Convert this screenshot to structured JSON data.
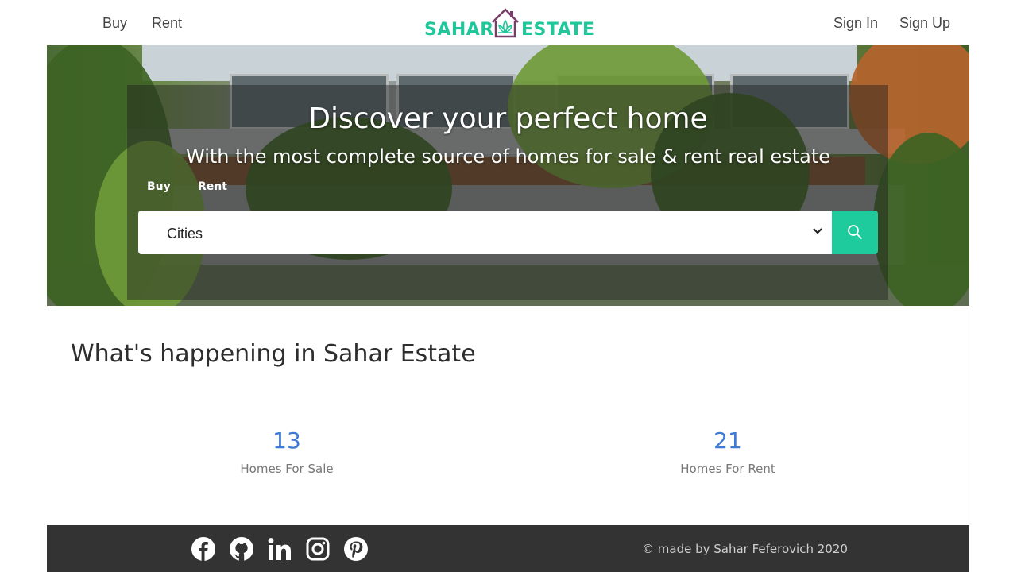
{
  "nav": {
    "buy": "Buy",
    "rent": "Rent",
    "sign_in": "Sign In",
    "sign_up": "Sign Up"
  },
  "logo": {
    "left_word": "SAHAR",
    "right_word": "ESTATE",
    "icon": "house-lotus-icon",
    "color": "#1fc79a"
  },
  "hero": {
    "title": "Discover your perfect home",
    "subtitle": "With the most complete source of homes for sale & rent real estate",
    "tabs": [
      "Buy",
      "Rent"
    ],
    "select_value": "Cities",
    "search_icon": "search-icon",
    "accent": "#1ecb9d"
  },
  "section": {
    "title": "What's happening in Sahar Estate",
    "stats": [
      {
        "value": "13",
        "label": "Homes For Sale"
      },
      {
        "value": "21",
        "label": "Homes For Rent"
      }
    ]
  },
  "footer": {
    "icons": [
      "facebook-icon",
      "github-icon",
      "linkedin-icon",
      "instagram-icon",
      "pinterest-icon"
    ],
    "copyright": "© made by Sahar Feferovich 2020"
  }
}
